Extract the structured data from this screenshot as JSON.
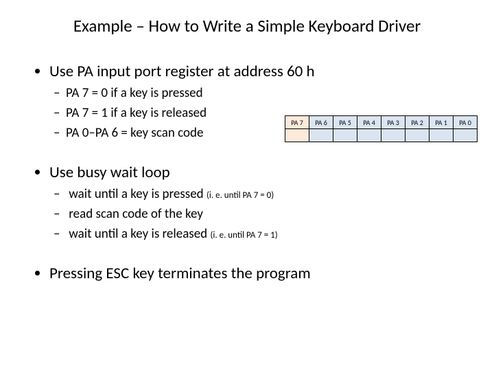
{
  "slide": {
    "title": "Example – How to Write a Simple Keyboard Driver",
    "bullet1": {
      "text": "Use PA input port register at address 60 h",
      "subs": [
        "PA 7 = 0 if a key is pressed",
        "PA 7 = 1 if a key is released",
        "PA 0–PA 6 = key scan code"
      ]
    },
    "bullet2": {
      "text": "Use busy wait loop",
      "subs": [
        {
          "main": "wait until a key is pressed ",
          "note": "(i. e. until PA 7 = 0)"
        },
        {
          "main": "read scan code of the key",
          "note": ""
        },
        {
          "main": "wait until a key is released ",
          "note": "(i. e. until PA 7 = 1)"
        }
      ]
    },
    "bullet3": {
      "text": "Pressing ESC key terminates the program"
    },
    "bit_table": {
      "cells": [
        "PA 7",
        "PA 6",
        "PA 5",
        "PA 4",
        "PA 3",
        "PA 2",
        "PA 1",
        "PA 0"
      ]
    },
    "colors": {
      "pa7_fill": "#fdeada",
      "rest_fill": "#dbe5f1"
    }
  }
}
